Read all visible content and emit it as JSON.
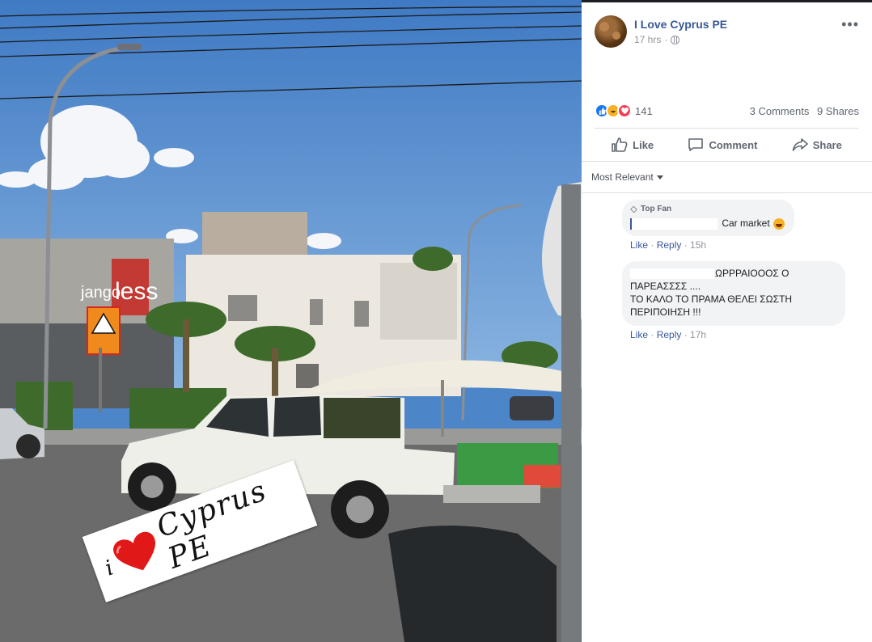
{
  "post": {
    "page_name": "I Love Cyprus PE",
    "time": "17 hrs",
    "reaction_count": "141",
    "comments_count": "3 Comments",
    "shares_count": "9 Shares",
    "actions": {
      "like": "Like",
      "comment": "Comment",
      "share": "Share"
    },
    "sort_label": "Most Relevant",
    "sticker": {
      "i": "i",
      "text": "Cyprus PE"
    },
    "shop_sign": "less",
    "shop_sign_left": "jango"
  },
  "comments": [
    {
      "badge": "Top Fan",
      "text": "Car market",
      "like": "Like",
      "reply": "Reply",
      "time": "15h"
    },
    {
      "line1": "ΩΡΡΡΑΙΟΟΟΣ Ο",
      "line2": "ΠΑΡΕΑΣΣΣΣ ....",
      "line3": "ΤΟ ΚΑΛΟ ΤΟ ΠΡΑΜΑ ΘΕΛΕΙ ΣΩΣΤΗ",
      "line4": "ΠΕΡΙΠΟΙΗΣΗ !!!",
      "like": "Like",
      "reply": "Reply",
      "time": "17h"
    }
  ]
}
